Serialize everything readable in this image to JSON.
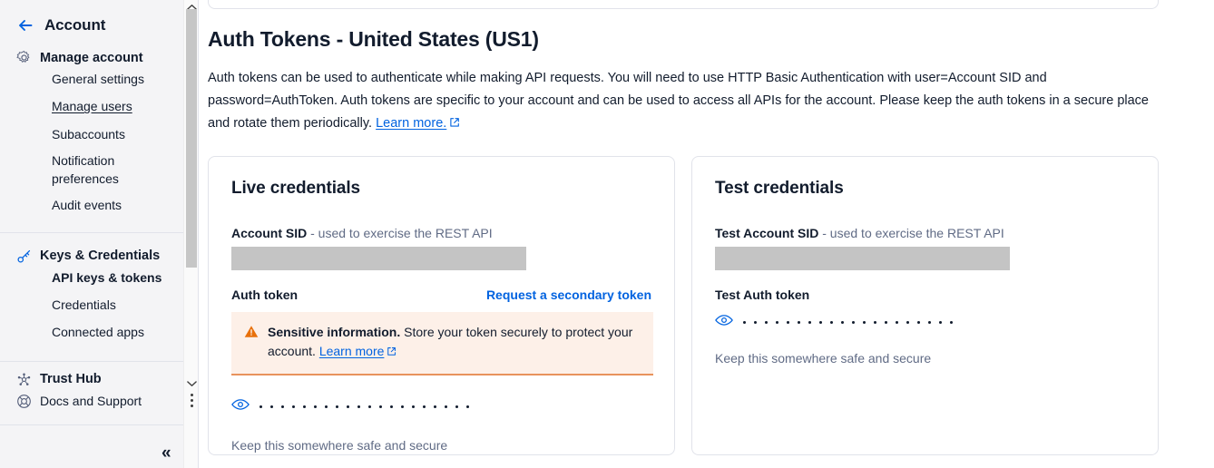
{
  "sidebar": {
    "back_icon": "arrow-left-icon",
    "title": "Account",
    "sections": [
      {
        "icon": "gear-icon",
        "label": "Manage account",
        "links": [
          {
            "label": "General settings",
            "state": "normal"
          },
          {
            "label": "Manage users",
            "state": "underlined"
          },
          {
            "label": "Subaccounts",
            "state": "normal"
          },
          {
            "label": "Notification preferences",
            "state": "wrap"
          },
          {
            "label": "Audit events",
            "state": "normal"
          }
        ]
      },
      {
        "icon": "key-icon",
        "label": "Keys & Credentials",
        "links": [
          {
            "label": "API keys & tokens",
            "state": "active"
          },
          {
            "label": "Credentials",
            "state": "normal"
          },
          {
            "label": "Connected apps",
            "state": "normal"
          }
        ]
      }
    ],
    "bottom": [
      {
        "icon": "trust-hub-icon",
        "label": "Trust Hub",
        "bold": true
      },
      {
        "icon": "lifebuoy-icon",
        "label": "Docs and Support",
        "bold": false
      }
    ],
    "scrollbar": {
      "up_icon": "chevron-up-icon",
      "down_icon": "chevron-down-icon",
      "kebab_icon": "kebab-menu-icon"
    },
    "collapse_label": "«"
  },
  "main": {
    "page_title": "Auth Tokens - United States (US1)",
    "intro_text": "Auth tokens can be used to authenticate while making API requests. You will need to use HTTP Basic Authentication with user=Account SID and password=AuthToken. Auth tokens are specific to your account and can be used to access all APIs for the account. Please keep the auth tokens in a secure place and rotate them periodically. ",
    "intro_link": "Learn more.",
    "external_icon": "external-link-icon"
  },
  "live_card": {
    "title": "Live credentials",
    "sid_label": "Account SID",
    "sid_desc": " - used to exercise the REST API",
    "sid_value_redacted": true,
    "token_label": "Auth token",
    "secondary_link": "Request a secondary token",
    "alert": {
      "icon": "warning-triangle-icon",
      "bold_text": "Sensitive information.",
      "body_text": " Store your token securely to protect your account. ",
      "link_text": "Learn more",
      "external_icon": "external-link-icon",
      "bg_color": "#fdf0e8",
      "accent_color": "#e8935c"
    },
    "eye_icon": "eye-icon",
    "masked_dots": 20,
    "hint": "Keep this somewhere safe and secure"
  },
  "test_card": {
    "title": "Test credentials",
    "sid_label": "Test Account SID",
    "sid_desc": " - used to exercise the REST API",
    "sid_value_redacted": true,
    "token_label": "Test Auth token",
    "eye_icon": "eye-icon",
    "masked_dots": 20,
    "hint": "Keep this somewhere safe and secure"
  },
  "colors": {
    "accent_blue": "#0263e0",
    "text_dark": "#121c2d",
    "text_muted": "#606b85",
    "sidebar_bg": "#f4f4f6",
    "border": "#e1e3ea",
    "redacted_gray": "#c4c4c4"
  }
}
